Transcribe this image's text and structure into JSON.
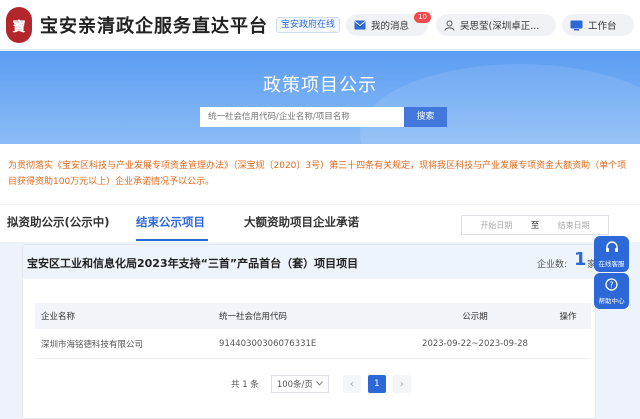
{
  "header": {
    "logo_text": "寶",
    "site_title": "宝安亲清政企服务直达平台",
    "site_link": "宝安政府在线",
    "messages_label": "我的消息",
    "messages_badge": "10",
    "user_label": "吴思莹(深圳卓正...",
    "workbench_label": "工作台"
  },
  "banner": {
    "title": "政策项目公示",
    "search_placeholder": "统一社会信用代码/企业名称/项目名称",
    "search_button": "搜索"
  },
  "notice": {
    "text": "为贯彻落实《宝安区科技与产业发展专项资金管理办法》（深宝规〔2020〕3号）第三十四条有关规定，现将我区科技与产业发展专项资金大额资助（单个项目获得资助100万元以上）企业承诺情况予以公示。"
  },
  "tabs": [
    {
      "label": "拟资助公示(公示中)"
    },
    {
      "label": "结束公示项目"
    },
    {
      "label": "大额资助项目企业承诺"
    }
  ],
  "date_filter": {
    "start_placeholder": "开始日期",
    "separator": "至",
    "end_placeholder": "结束日期"
  },
  "project": {
    "title": "宝安区工业和信息化局2023年支持“三首”产品首台（套）项目项目",
    "count_label": "企业数:",
    "count_value": "1",
    "count_unit": "家"
  },
  "table": {
    "headers": [
      "企业名称",
      "统一社会信用代码",
      "公示期",
      "操作"
    ],
    "rows": [
      [
        "深圳市海铭德科技有限公司",
        "91440300306076331E",
        "2023-09-22~2023-09-28",
        ""
      ]
    ]
  },
  "pagination": {
    "total": "共 1 条",
    "page_size": "100条/页",
    "current_page": "1",
    "prev": "‹",
    "next": "›"
  },
  "floating": {
    "service_label": "在线客服",
    "help_label": "帮助中心"
  },
  "colors": {
    "primary": "#2d68d8",
    "notice": "#e06a1d",
    "badge": "#f04a4a"
  }
}
